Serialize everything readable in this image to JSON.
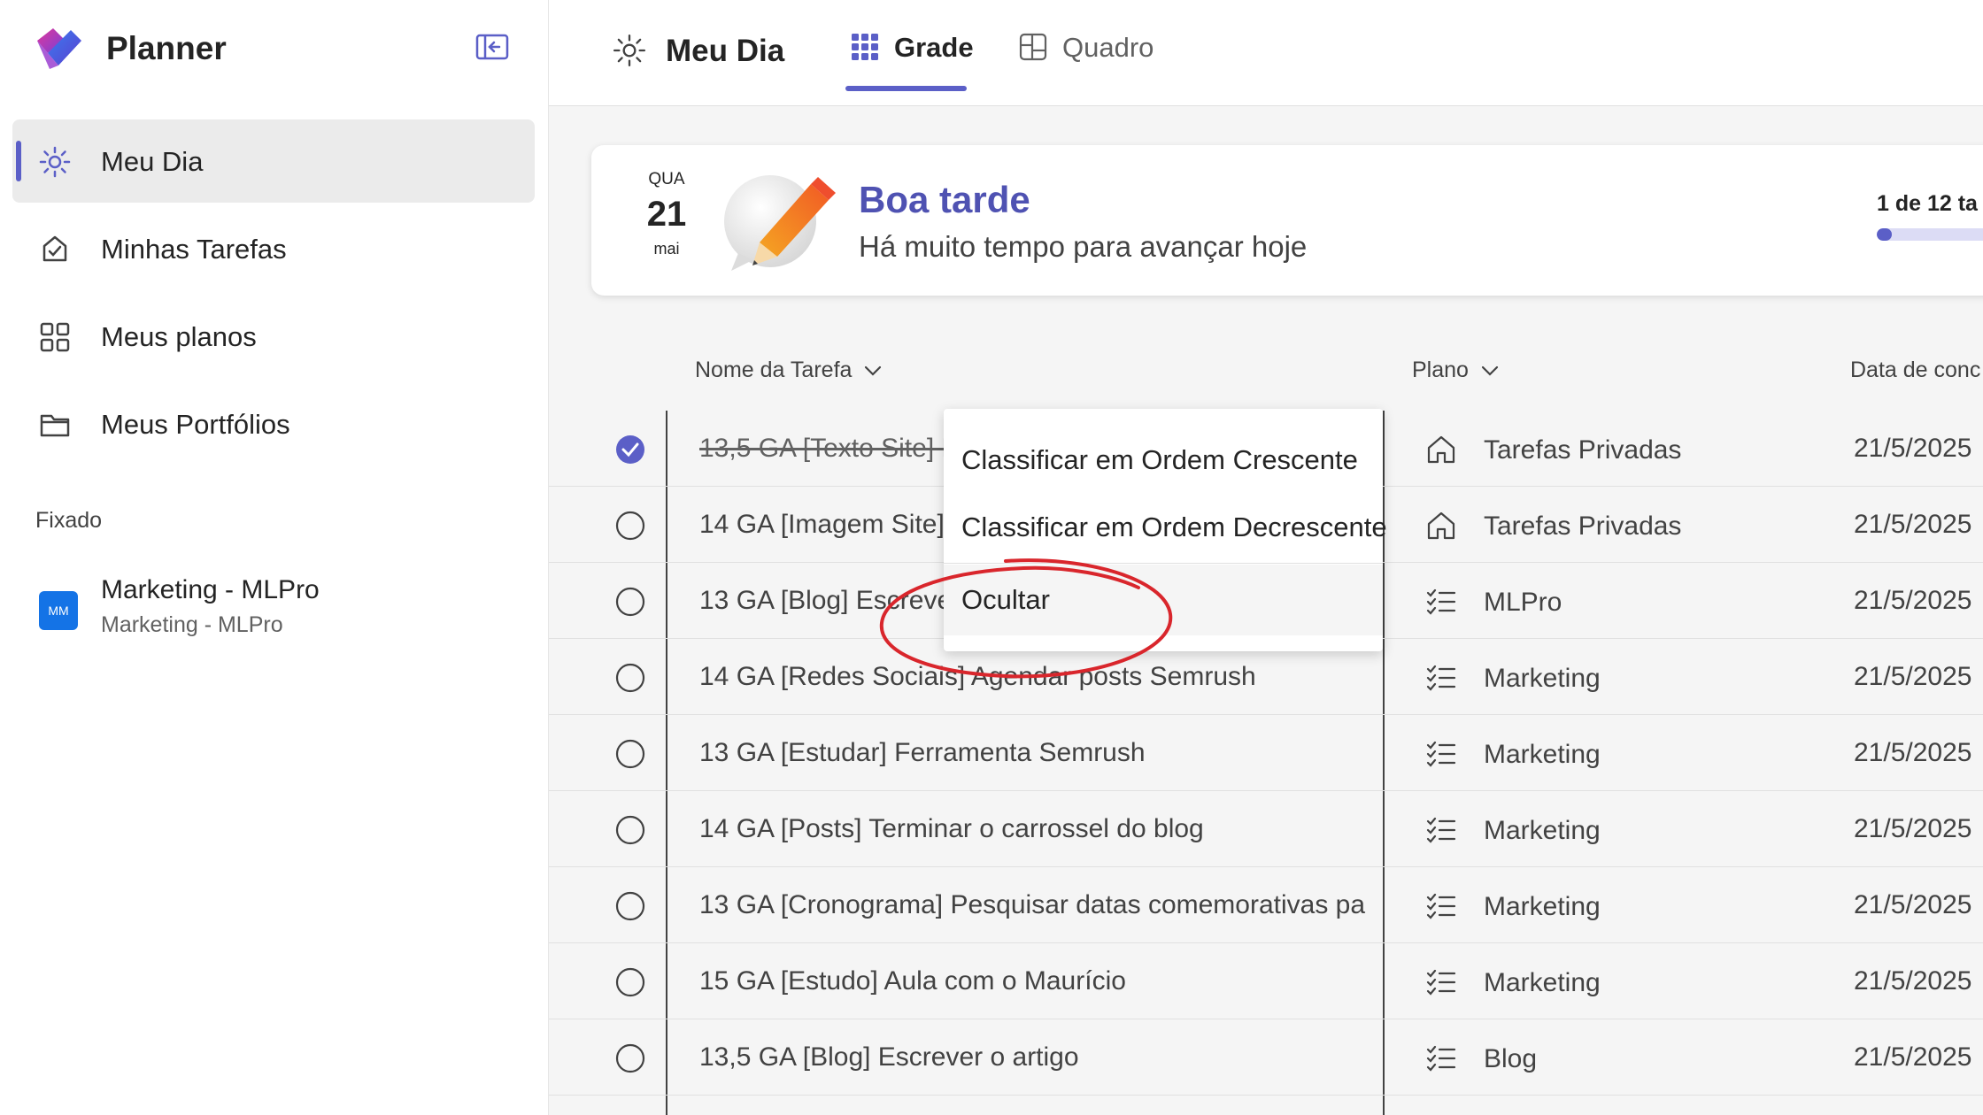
{
  "app": {
    "name": "Planner"
  },
  "sidebar": {
    "items": [
      {
        "label": "Meu Dia",
        "icon": "sun-icon",
        "active": true
      },
      {
        "label": "Minhas Tarefas",
        "icon": "task-check-icon",
        "active": false
      },
      {
        "label": "Meus planos",
        "icon": "grid-apps-icon",
        "active": false
      },
      {
        "label": "Meus Portfólios",
        "icon": "folder-icon",
        "active": false
      }
    ],
    "pinned_label": "Fixado",
    "pinned": [
      {
        "badge": "MM",
        "title": "Marketing - MLPro",
        "subtitle": "Marketing - MLPro"
      }
    ]
  },
  "topbar": {
    "title": "Meu Dia",
    "tabs": [
      {
        "label": "Grade",
        "icon": "grid-icon",
        "selected": true
      },
      {
        "label": "Quadro",
        "icon": "board-icon",
        "selected": false
      }
    ]
  },
  "greeting": {
    "day_of_week": "QUA",
    "day": "21",
    "month": "mai",
    "title": "Boa tarde",
    "subtitle": "Há muito tempo para avançar hoje",
    "progress_label": "1 de 12 ta",
    "progress_fraction": 0.083
  },
  "grid": {
    "headers": {
      "task": "Nome da Tarefa",
      "plan": "Plano",
      "due": "Data de conc"
    },
    "rows": [
      {
        "name": "13,5 GA [Texto Site] E",
        "plan": "Tarefas Privadas",
        "plan_icon": "home-icon",
        "due": "21/5/2025",
        "done": true
      },
      {
        "name": "14 GA [Imagem Site]",
        "plan": "Tarefas Privadas",
        "plan_icon": "home-icon",
        "due": "21/5/2025",
        "done": false
      },
      {
        "name": "13 GA [Blog] Escrever",
        "plan": "MLPro",
        "plan_icon": "list-icon",
        "due": "21/5/2025",
        "done": false
      },
      {
        "name": "14 GA [Redes Sociais] Agendar posts Semrush",
        "plan": "Marketing",
        "plan_icon": "list-icon",
        "due": "21/5/2025",
        "done": false
      },
      {
        "name": "13 GA [Estudar] Ferramenta Semrush",
        "plan": "Marketing",
        "plan_icon": "list-icon",
        "due": "21/5/2025",
        "done": false
      },
      {
        "name": "14 GA [Posts] Terminar o carrossel do blog",
        "plan": "Marketing",
        "plan_icon": "list-icon",
        "due": "21/5/2025",
        "done": false
      },
      {
        "name": "13 GA [Cronograma] Pesquisar datas comemorativas pa",
        "plan": "Marketing",
        "plan_icon": "list-icon",
        "due": "21/5/2025",
        "done": false
      },
      {
        "name": "15 GA [Estudo] Aula com o Maurício",
        "plan": "Marketing",
        "plan_icon": "list-icon",
        "due": "21/5/2025",
        "done": false
      },
      {
        "name": "13,5 GA [Blog] Escrever o artigo",
        "plan": "Blog",
        "plan_icon": "list-icon",
        "due": "21/5/2025",
        "done": false
      }
    ]
  },
  "context_menu": {
    "items": [
      {
        "label": "Classificar em Ordem Crescente"
      },
      {
        "label": "Classificar em Ordem Decrescente"
      },
      {
        "label": "Ocultar"
      }
    ]
  },
  "colors": {
    "accent": "#5b5fc7",
    "greeting_title": "#4f52b2",
    "annotation": "#d9262c"
  }
}
